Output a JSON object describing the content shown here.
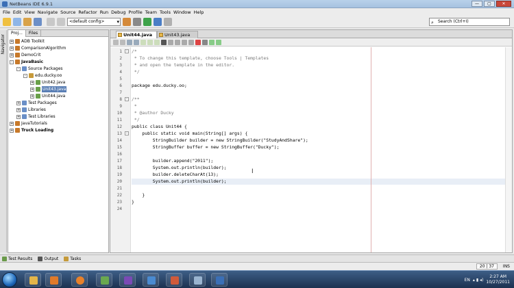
{
  "window": {
    "title": "NetBeans IDE 6.9.1",
    "colors": {
      "accent": "#3b6fb6",
      "close": "#c9473a"
    }
  },
  "menu": [
    "File",
    "Edit",
    "View",
    "Navigate",
    "Source",
    "Refactor",
    "Run",
    "Debug",
    "Profile",
    "Team",
    "Tools",
    "Window",
    "Help"
  ],
  "toolbar": {
    "config": "<default config>"
  },
  "search": {
    "placeholder": "Search (Ctrl+I)"
  },
  "left_strip": {
    "navigator": "Navigator"
  },
  "projects_panel": {
    "tabs": [
      "Proj...",
      "Files"
    ],
    "tree": [
      {
        "label": "ADB Toolkit",
        "depth": 0,
        "exp": "+"
      },
      {
        "label": "ComparisonAlgorithm",
        "depth": 0,
        "exp": "+"
      },
      {
        "label": "DemoCrit",
        "depth": 0,
        "exp": "+"
      },
      {
        "label": "JavaBasic",
        "depth": 0,
        "exp": "-"
      },
      {
        "label": "Source Packages",
        "depth": 1,
        "exp": "-"
      },
      {
        "label": "edu.ducky.oo",
        "depth": 2,
        "exp": "-"
      },
      {
        "label": "Unit42.java",
        "depth": 3,
        "exp": "+"
      },
      {
        "label": "Unit43.java",
        "depth": 3,
        "exp": "+"
      },
      {
        "label": "Unit44.java",
        "depth": 3,
        "exp": "+"
      },
      {
        "label": "Test Packages",
        "depth": 1,
        "exp": "+"
      },
      {
        "label": "Libraries",
        "depth": 1,
        "exp": "+"
      },
      {
        "label": "Test Libraries",
        "depth": 1,
        "exp": "+"
      },
      {
        "label": "JavaTutorials",
        "depth": 0,
        "exp": "+"
      },
      {
        "label": "Truck Loading",
        "depth": 0,
        "exp": "+"
      }
    ]
  },
  "editor": {
    "tabs": [
      {
        "label": "Unit44.java",
        "active": true
      },
      {
        "label": "Unit43.java",
        "active": false
      }
    ],
    "lines": [
      {
        "n": "1",
        "t": "/*",
        "c": true,
        "fold": "-"
      },
      {
        "n": "2",
        "t": " * To change this template, choose Tools | Templates",
        "c": true
      },
      {
        "n": "3",
        "t": " * and open the template in the editor.",
        "c": true
      },
      {
        "n": "4",
        "t": " */",
        "c": true
      },
      {
        "n": "5",
        "t": ""
      },
      {
        "n": "6",
        "t": "package edu.ducky.oo;"
      },
      {
        "n": "7",
        "t": ""
      },
      {
        "n": "8",
        "t": "/**",
        "c": true,
        "fold": "-"
      },
      {
        "n": "9",
        "t": " *",
        "c": true
      },
      {
        "n": "10",
        "t": " * @author Ducky",
        "c": true
      },
      {
        "n": "11",
        "t": " */",
        "c": true
      },
      {
        "n": "12",
        "t": "public class Unit44 {"
      },
      {
        "n": "13",
        "t": "    public static void main(String[] args) {",
        "fold": "-"
      },
      {
        "n": "14",
        "t": "        StringBuilder builder = new StringBuilder(\"StudyAndShare\");"
      },
      {
        "n": "15",
        "t": "        StringBuffer buffer = new StringBuffer(\"Ducky\");"
      },
      {
        "n": "16",
        "t": ""
      },
      {
        "n": "17",
        "t": "        builder.append(\"2011\");"
      },
      {
        "n": "18",
        "t": "        System.out.println(builder);"
      },
      {
        "n": "19",
        "t": "        builder.deleteCharAt(13);"
      },
      {
        "n": "20",
        "t": "        System.out.println(builder);",
        "cur": true
      },
      {
        "n": "21",
        "t": ""
      },
      {
        "n": "22",
        "t": "    }"
      },
      {
        "n": "23",
        "t": "}"
      },
      {
        "n": "24",
        "t": ""
      }
    ]
  },
  "bottom_tabs": [
    "Test Results",
    "Output",
    "Tasks"
  ],
  "status": {
    "position": "20 | 37",
    "mode": "INS"
  },
  "taskbar": {
    "lang": "EN",
    "time": "2:27 AM",
    "date": "10/27/2011",
    "apps": [
      "folder-icon",
      "media-icon",
      "firefox-icon",
      "paint-icon",
      "game-icon",
      "windows-icon",
      "slides-icon",
      "box-icon",
      "netbeans-icon"
    ]
  }
}
